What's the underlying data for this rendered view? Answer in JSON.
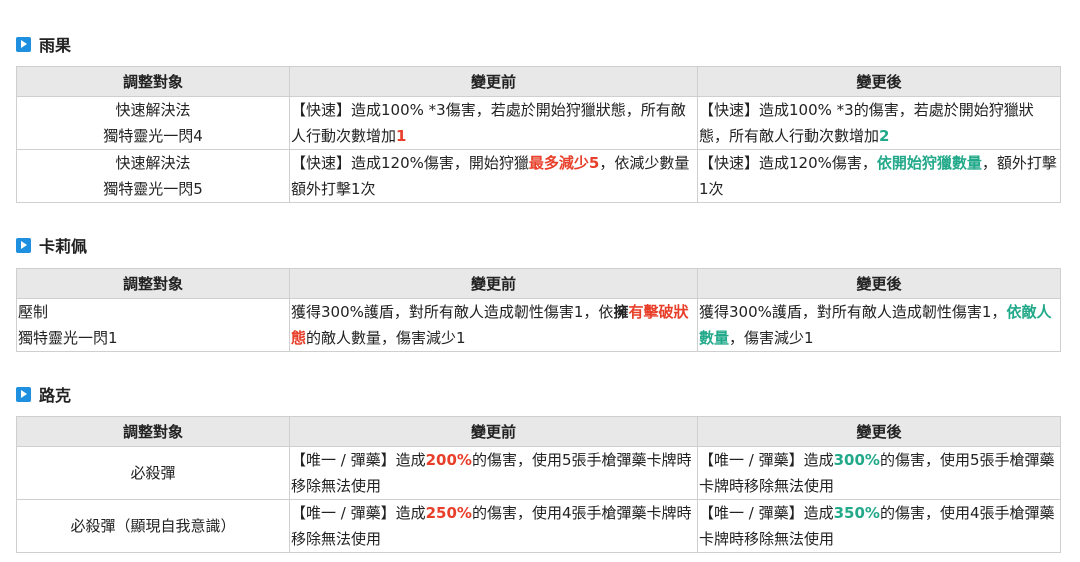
{
  "columns": {
    "target": "調整對象",
    "before": "變更前",
    "after": "變更後"
  },
  "sections": [
    {
      "title": "雨果",
      "rows": [
        {
          "target": [
            "快速解決法",
            "獨特靈光一閃4"
          ],
          "before": [
            {
              "t": "【快速】造成100% *3傷害，若處於開始狩獵狀態，所有敵人行動次數增加"
            },
            {
              "t": "1",
              "s": "red"
            }
          ],
          "after": [
            {
              "t": "【快速】造成100% *3的傷害，若處於開始狩獵狀態，所有敵人行動次數增加"
            },
            {
              "t": "2",
              "s": "green"
            }
          ]
        },
        {
          "target": [
            "快速解決法",
            "獨特靈光一閃5"
          ],
          "before": [
            {
              "t": "【快速】造成120%傷害，開始狩獵"
            },
            {
              "t": "最多減少5",
              "s": "red"
            },
            {
              "t": "，依減少數量額外打擊1次"
            }
          ],
          "after": [
            {
              "t": "【快速】造成120%傷害，"
            },
            {
              "t": "依開始狩獵數量",
              "s": "green"
            },
            {
              "t": "，額外打擊1次"
            }
          ]
        }
      ]
    },
    {
      "title": "卡莉佩",
      "rows": [
        {
          "target": [
            "壓制",
            "獨特靈光一閃1"
          ],
          "before": [
            {
              "t": "獲得300%護盾，對所有敵人造成韌性傷害1，依"
            },
            {
              "t": "擁",
              "s": "blk"
            },
            {
              "t": "有擊破狀態",
              "s": "red"
            },
            {
              "t": "的敵人數量，傷害減少1"
            }
          ],
          "after": [
            {
              "t": "獲得300%護盾，對所有敵人造成韌性傷害1，"
            },
            {
              "t": "依敵人數量",
              "s": "green"
            },
            {
              "t": "，傷害減少1"
            }
          ]
        }
      ]
    },
    {
      "title": "路克",
      "rows": [
        {
          "target": [
            "必殺彈"
          ],
          "before": [
            {
              "t": "【唯一 / 彈藥】造成"
            },
            {
              "t": "200%",
              "s": "red"
            },
            {
              "t": "的傷害，使用5張手槍彈藥卡牌時移除無法使用"
            }
          ],
          "after": [
            {
              "t": "【唯一 / 彈藥】造成"
            },
            {
              "t": "300%",
              "s": "green"
            },
            {
              "t": "的傷害，使用5張手槍彈藥卡牌時移除無法使用"
            }
          ]
        },
        {
          "target": [
            "必殺彈（顯現自我意識）"
          ],
          "before": [
            {
              "t": "【唯一 / 彈藥】造成"
            },
            {
              "t": "250%",
              "s": "red"
            },
            {
              "t": "的傷害，使用4張手槍彈藥卡牌時移除無法使用"
            }
          ],
          "after": [
            {
              "t": "【唯一 / 彈藥】造成"
            },
            {
              "t": "350%",
              "s": "green"
            },
            {
              "t": "的傷害，使用4張手槍彈藥卡牌時移除無法使用"
            }
          ]
        }
      ]
    }
  ]
}
